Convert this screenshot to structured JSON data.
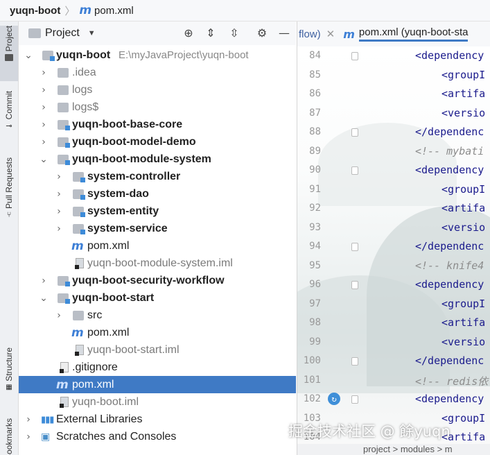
{
  "breadcrumb": {
    "project": "yuqn-boot",
    "file": "pom.xml"
  },
  "tool_strip": {
    "tabs": [
      "Project",
      "Commit",
      "Pull Requests",
      "Structure",
      "Bookmarks"
    ]
  },
  "project_panel": {
    "title": "Project"
  },
  "tree": [
    {
      "label": "yuqn-boot",
      "path": "E:\\myJavaProject\\yuqn-boot"
    },
    {
      "label": ".idea"
    },
    {
      "label": "logs"
    },
    {
      "label": "logs$"
    },
    {
      "label": "yuqn-boot-base-core"
    },
    {
      "label": "yuqn-boot-model-demo"
    },
    {
      "label": "yuqn-boot-module-system"
    },
    {
      "label": "system-controller"
    },
    {
      "label": "system-dao"
    },
    {
      "label": "system-entity"
    },
    {
      "label": "system-service"
    },
    {
      "label": "pom.xml"
    },
    {
      "label": "yuqn-boot-module-system.iml"
    },
    {
      "label": "yuqn-boot-security-workflow"
    },
    {
      "label": "yuqn-boot-start"
    },
    {
      "label": "src"
    },
    {
      "label": "pom.xml"
    },
    {
      "label": "yuqn-boot-start.iml"
    },
    {
      "label": ".gitignore"
    },
    {
      "label": "pom.xml"
    },
    {
      "label": "yuqn-boot.iml"
    },
    {
      "label": "External Libraries"
    },
    {
      "label": "Scratches and Consoles"
    }
  ],
  "editor": {
    "tabs": [
      {
        "label": "flow)"
      },
      {
        "label": "pom.xml (yuqn-boot-sta"
      }
    ],
    "lines": [
      {
        "n": "84",
        "text": "<dependency"
      },
      {
        "n": "85",
        "text": "<groupI"
      },
      {
        "n": "86",
        "text": "<artifa"
      },
      {
        "n": "87",
        "text": "<versio"
      },
      {
        "n": "88",
        "text": "</dependenc"
      },
      {
        "n": "89",
        "text": "<!-- mybati"
      },
      {
        "n": "90",
        "text": "<dependency"
      },
      {
        "n": "91",
        "text": "<groupI"
      },
      {
        "n": "92",
        "text": "<artifa"
      },
      {
        "n": "93",
        "text": "<versio"
      },
      {
        "n": "94",
        "text": "</dependenc"
      },
      {
        "n": "95",
        "text": "<!-- knife4"
      },
      {
        "n": "96",
        "text": "<dependency"
      },
      {
        "n": "97",
        "text": "<groupI"
      },
      {
        "n": "98",
        "text": "<artifa"
      },
      {
        "n": "99",
        "text": "<versio"
      },
      {
        "n": "100",
        "text": "</dependenc"
      },
      {
        "n": "101",
        "text": "<!-- redis依"
      },
      {
        "n": "102",
        "text": "<dependency"
      },
      {
        "n": "103",
        "text": "<groupI"
      },
      {
        "n": "104",
        "text": "<artifa"
      }
    ]
  },
  "statusbar": {
    "text": "project  >  modules  >  m"
  },
  "watermark": "掘金技术社区 @ 餘yuqn"
}
